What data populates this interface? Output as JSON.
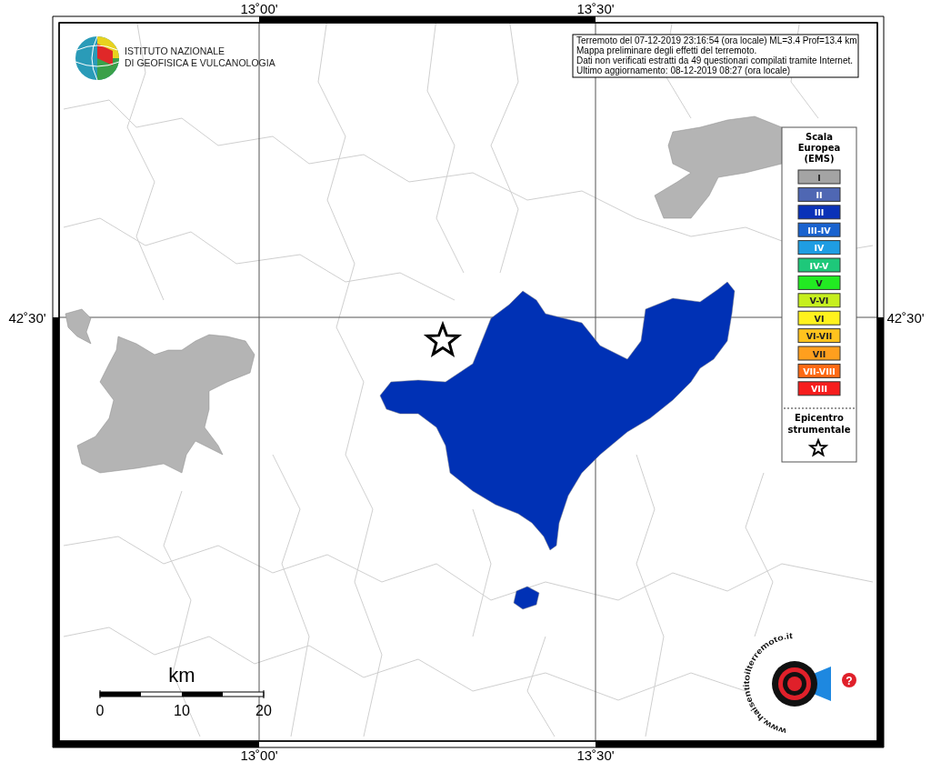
{
  "logo": {
    "lines": [
      "ISTITUTO NAZIONALE",
      "DI GEOFISICA E VULCANOLOGIA"
    ]
  },
  "info_box": {
    "lines": [
      "Terremoto del 07-12-2019 23:16:54 (ora locale) ML=3.4 Prof=13.4 km",
      "Mappa preliminare degli effetti del terremoto.",
      "Dati non verificati estratti da 49 questionari compilati tramite Internet.",
      "Ultimo aggiornamento: 08-12-2019 08:27 (ora locale)"
    ]
  },
  "axes": {
    "top": [
      "13˚00'",
      "13˚30'"
    ],
    "bottom": [
      "13˚00'",
      "13˚30'"
    ],
    "left": [
      "42˚30'"
    ],
    "right": [
      "42˚30'"
    ]
  },
  "areas": [
    {
      "color": "#0031b5"
    },
    {
      "color": "#0031b5"
    },
    {
      "color": "#b4b4b4"
    },
    {
      "color": "#b4b4b4"
    },
    {
      "color": "#b4b4b4"
    }
  ],
  "legend": {
    "title": [
      "Scala",
      "Europea",
      "(EMS)"
    ],
    "items": [
      {
        "label": "I",
        "color": "#a4a4a4"
      },
      {
        "label": "II",
        "color": "#4f67b3"
      },
      {
        "label": "III",
        "color": "#0a32b8"
      },
      {
        "label": "III-IV",
        "color": "#1a63cf"
      },
      {
        "label": "IV",
        "color": "#1f9de3"
      },
      {
        "label": "IV-V",
        "color": "#1ec87a"
      },
      {
        "label": "V",
        "color": "#22ea22"
      },
      {
        "label": "V-VI",
        "color": "#c6ef1e"
      },
      {
        "label": "VI",
        "color": "#fff21e"
      },
      {
        "label": "VI-VII",
        "color": "#ffc31e"
      },
      {
        "label": "VII",
        "color": "#ff9f1e"
      },
      {
        "label": "VII-VIII",
        "color": "#ff6a14"
      },
      {
        "label": "VIII",
        "color": "#f71e1e"
      }
    ],
    "epicenter": [
      "Epicentro",
      "strumentale"
    ]
  },
  "scale_bar": {
    "unit": "km",
    "ticks": [
      "0",
      "10",
      "20"
    ]
  },
  "badge": {
    "text": "www.haisentitoilterremoto.it",
    "mark": "?"
  }
}
